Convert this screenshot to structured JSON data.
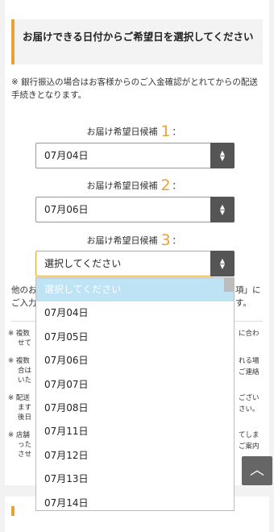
{
  "heading": "お届けできる日付からご希望日を選択してください",
  "note": "※ 銀行振込の場合はお客様からのご入金確認がとれてからの配送手続きとなります。",
  "candidates": [
    {
      "label": "お届け希望日候補",
      "num": "1",
      "colon": "：",
      "value": "07月04日"
    },
    {
      "label": "お届け希望日候補",
      "num": "2",
      "colon": "：",
      "value": "07月06日"
    },
    {
      "label": "お届け希望日候補",
      "num": "3",
      "colon": "：",
      "value": "選択してください"
    }
  ],
  "under_text": {
    "left1": "他のお",
    "left2": "ご入力",
    "right1": "項」に",
    "right2": "す。"
  },
  "notes_left": [
    "※ 複数",
    "せて",
    "※ 複数",
    "合は",
    "いた",
    "※ 配送",
    "ます",
    "後日",
    "※ 店舗",
    "った",
    "させ"
  ],
  "notes_right": [
    "に合わ",
    "れる場",
    "ご連絡",
    "ござい",
    "さい。",
    "てしま",
    "ご案内"
  ],
  "dropdown": {
    "options": [
      "選択してください",
      "07月04日",
      "07月05日",
      "07月06日",
      "07月07日",
      "07月08日",
      "07月11日",
      "07月12日",
      "07月13日",
      "07月14日"
    ],
    "selected_index": 0
  },
  "icons": {
    "to_top": "chevron-up-icon",
    "select_toggle": "up-down-arrows-icon"
  },
  "colors": {
    "accent": "#e8a23a",
    "select_button": "#555555",
    "highlight": "#bde3f5"
  }
}
